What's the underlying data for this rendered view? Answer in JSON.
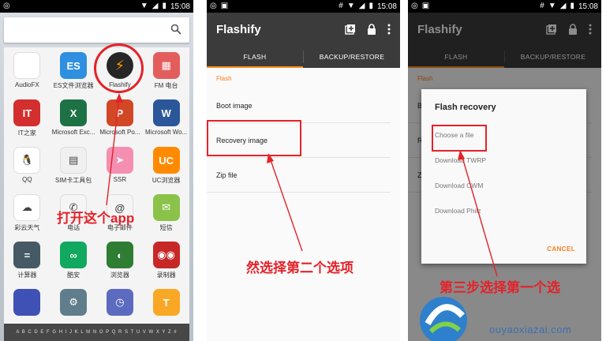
{
  "status": {
    "time": "15:08"
  },
  "phone1": {
    "apps": [
      {
        "label": "AudioFX",
        "icon": "audiofx-icon",
        "color": "#ffffff",
        "glyph": ""
      },
      {
        "label": "ES文件浏览器",
        "icon": "es-folder-icon",
        "color": "#2f8fe0",
        "glyph": "ES"
      },
      {
        "label": "Flashify",
        "icon": "flash-bolt-icon",
        "color": "#262626",
        "glyph": "⚡"
      },
      {
        "label": "FM 电台",
        "icon": "radio-icon",
        "color": "#e35d5d",
        "glyph": "▦"
      },
      {
        "label": "IT之家",
        "icon": "it-home-icon",
        "color": "#d32f2f",
        "glyph": "IT"
      },
      {
        "label": "Microsoft Exc...",
        "icon": "excel-icon",
        "color": "#1e7145",
        "glyph": "X"
      },
      {
        "label": "Microsoft Po...",
        "icon": "powerpoint-icon",
        "color": "#d24726",
        "glyph": "P"
      },
      {
        "label": "Microsoft Wo...",
        "icon": "word-icon",
        "color": "#2b579a",
        "glyph": "W"
      },
      {
        "label": "QQ",
        "icon": "qq-penguin-icon",
        "color": "#ffffff",
        "glyph": "🐧"
      },
      {
        "label": "SIM卡工具包",
        "icon": "sim-card-icon",
        "color": "#f0f0f0",
        "glyph": "▤"
      },
      {
        "label": "SSR",
        "icon": "paper-plane-icon",
        "color": "#f48fb1",
        "glyph": "➤"
      },
      {
        "label": "UC浏览器",
        "icon": "uc-browser-icon",
        "color": "#ff8a00",
        "glyph": "UC"
      },
      {
        "label": "彩云天气",
        "icon": "cloud-icon",
        "color": "#ffffff",
        "glyph": "☁"
      },
      {
        "label": "电话",
        "icon": "phone-icon",
        "color": "#f5f5f5",
        "glyph": "✆"
      },
      {
        "label": "电子邮件",
        "icon": "email-icon",
        "color": "#f5f5f5",
        "glyph": "@"
      },
      {
        "label": "短信",
        "icon": "sms-icon",
        "color": "#8bc34a",
        "glyph": "✉"
      },
      {
        "label": "计算器",
        "icon": "calculator-icon",
        "color": "#455a64",
        "glyph": "="
      },
      {
        "label": "酷安",
        "icon": "coolapk-icon",
        "color": "#11a860",
        "glyph": "∞"
      },
      {
        "label": "浏览器",
        "icon": "browser-icon",
        "color": "#2e7d32",
        "glyph": "◐"
      },
      {
        "label": "录制器",
        "icon": "recorder-icon",
        "color": "#c62828",
        "glyph": "◉◉"
      },
      {
        "label": "",
        "icon": "app-icon",
        "color": "#3f51b5",
        "glyph": ""
      },
      {
        "label": "",
        "icon": "settings-icon",
        "color": "#607d8b",
        "glyph": "⚙"
      },
      {
        "label": "",
        "icon": "clock-icon",
        "color": "#5c6bc0",
        "glyph": "◷"
      },
      {
        "label": "",
        "icon": "tools-icon",
        "color": "#f9a825",
        "glyph": "T"
      }
    ],
    "alphabet": "A B C D E F G H I J K L M N O P Q R S T U V W X Y Z #",
    "annotation": "打开这个app"
  },
  "flashify": {
    "title": "Flashify",
    "tabs": [
      "FLASH",
      "BACKUP/RESTORE"
    ],
    "section": "Flash",
    "items": [
      "Boot image",
      "Recovery image",
      "Zip file"
    ],
    "annotation": "然选择第二个选项"
  },
  "dialog": {
    "title": "Flash recovery",
    "options": [
      "Choose a file",
      "Download TWRP",
      "Download CWM",
      "Download Philz"
    ],
    "cancel": "CANCEL",
    "annotation": "第三步选择第一个选"
  },
  "watermark": {
    "url": "ouyaoxiazai.com"
  },
  "colors": {
    "accent": "#ff7c1f",
    "annotation": "#e4222a",
    "appbar": "#3b3b3b"
  }
}
